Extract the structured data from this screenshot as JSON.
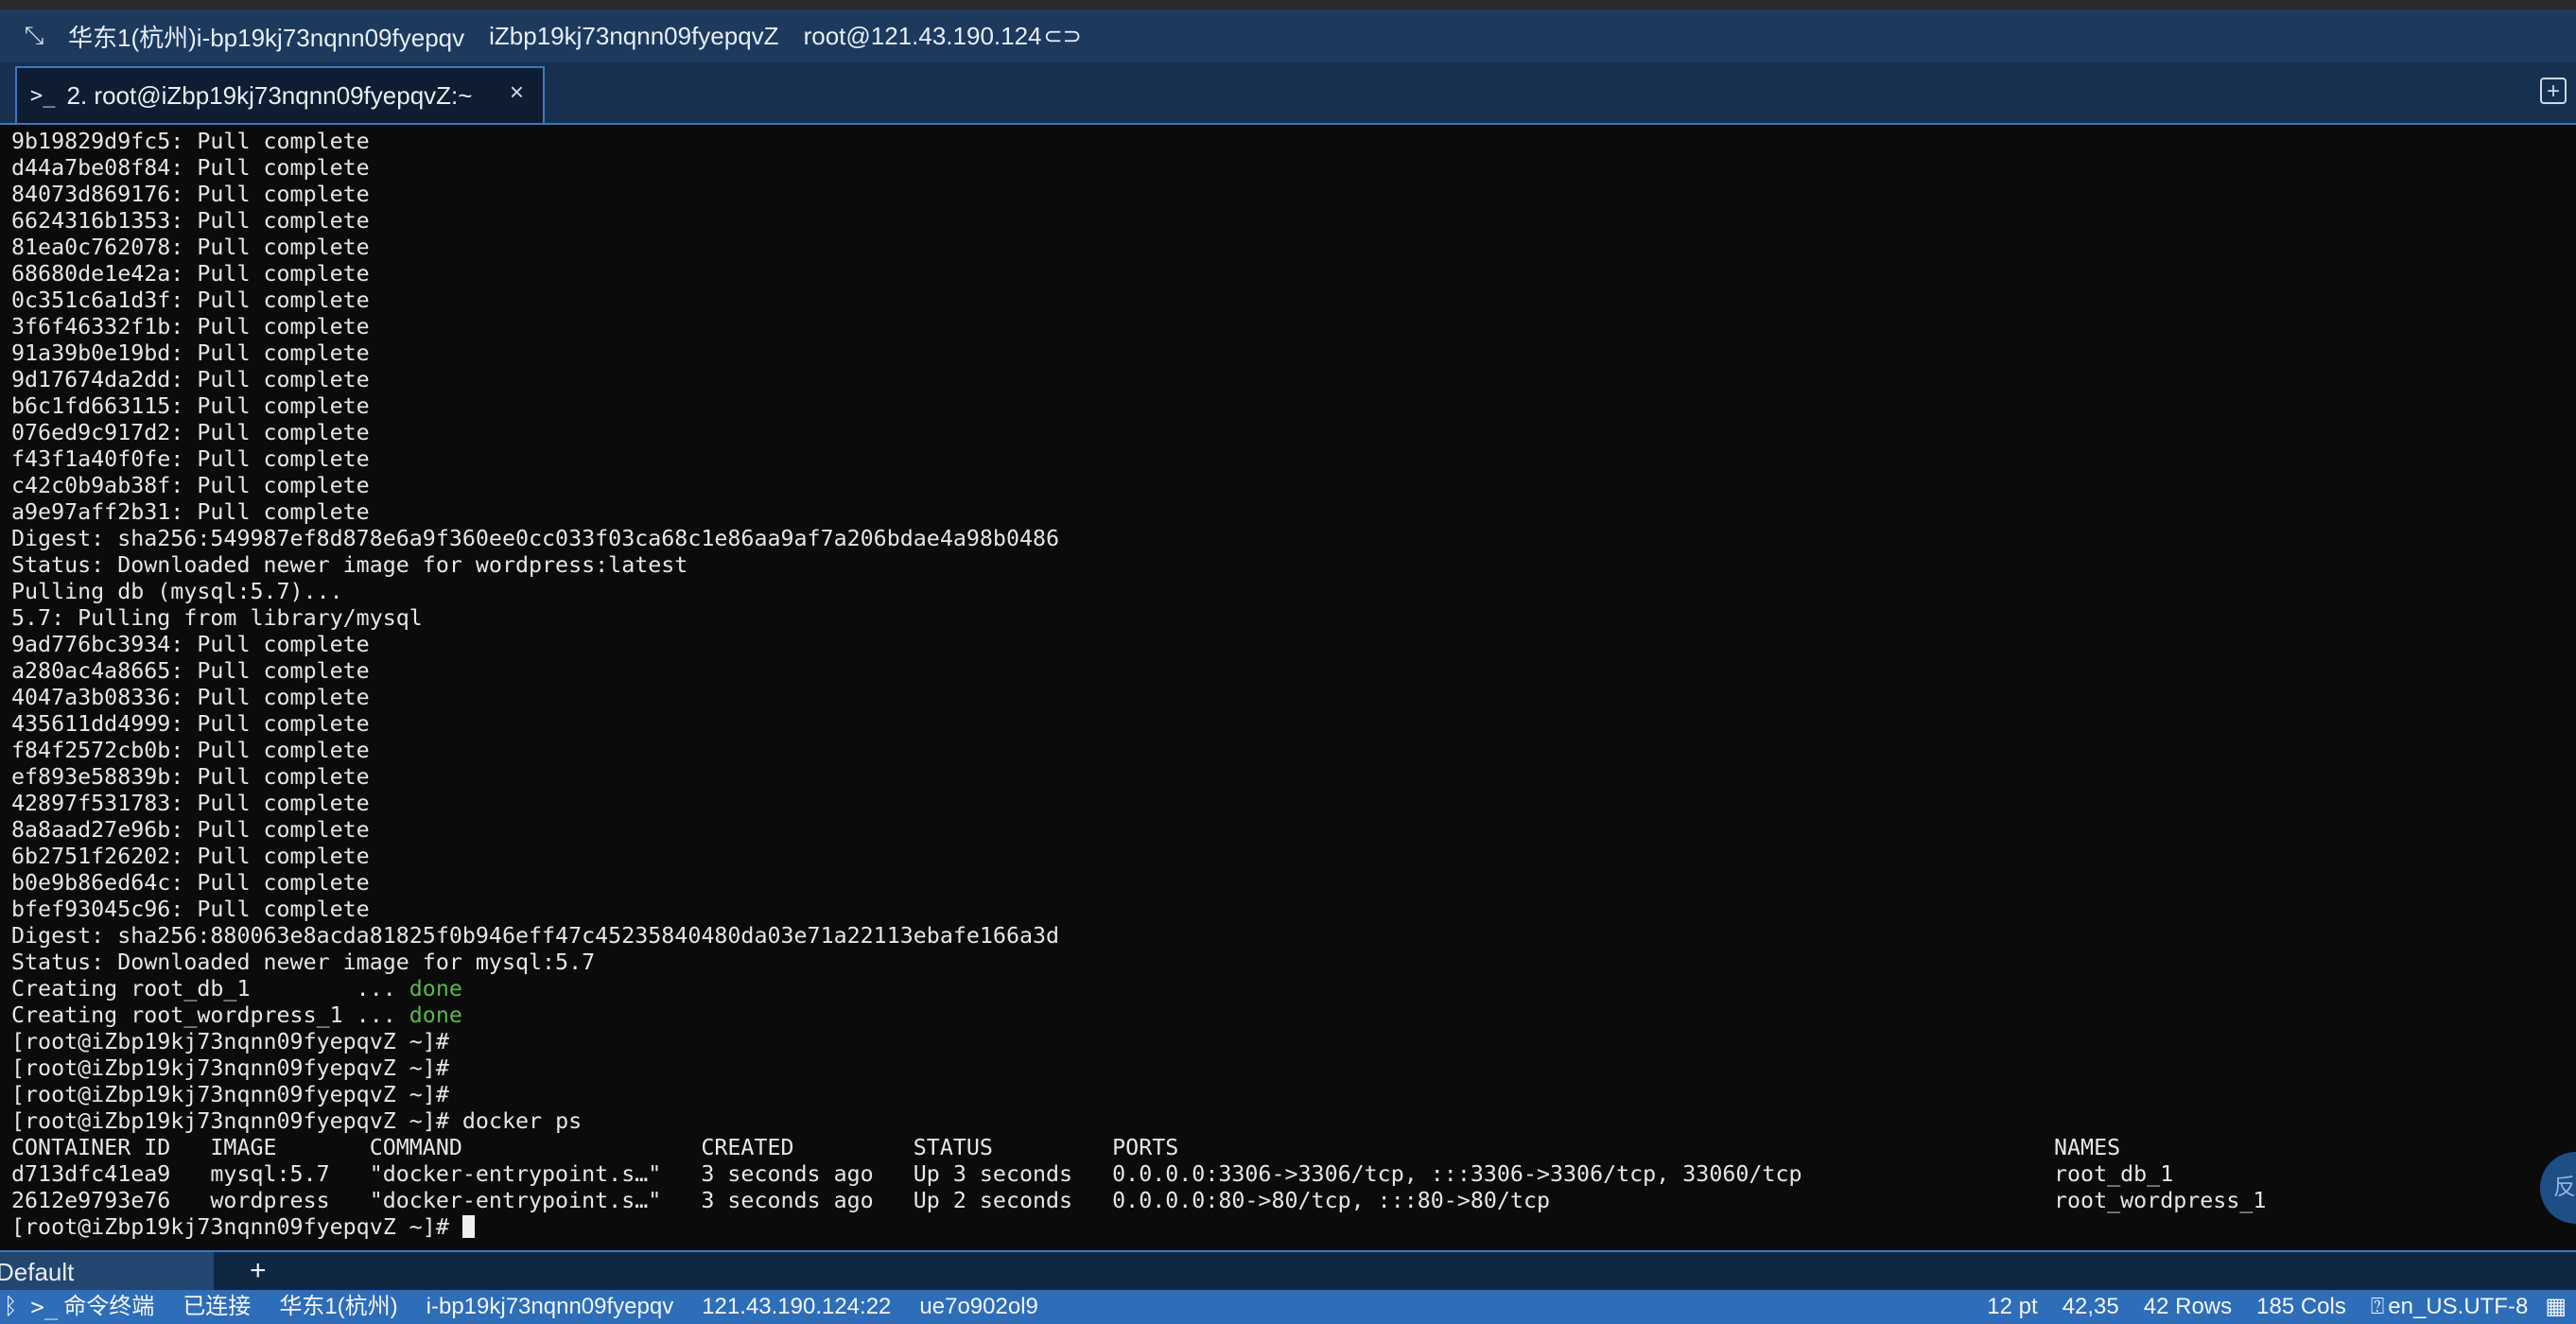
{
  "window": {
    "region": "华东1(杭州)i-bp19kj73nqnn09fyepqv",
    "hostname": "iZbp19kj73nqnn09fyepqvZ",
    "connection": "root@121.43.190.124"
  },
  "tab": {
    "label": "2. root@iZbp19kj73nqnn09fyepqvZ:~",
    "close": "×"
  },
  "terminal": {
    "lines": [
      "9b19829d9fc5: Pull complete",
      "d44a7be08f84: Pull complete",
      "84073d869176: Pull complete",
      "6624316b1353: Pull complete",
      "81ea0c762078: Pull complete",
      "68680de1e42a: Pull complete",
      "0c351c6a1d3f: Pull complete",
      "3f6f46332f1b: Pull complete",
      "91a39b0e19bd: Pull complete",
      "9d17674da2dd: Pull complete",
      "b6c1fd663115: Pull complete",
      "076ed9c917d2: Pull complete",
      "f43f1a40f0fe: Pull complete",
      "c42c0b9ab38f: Pull complete",
      "a9e97aff2b31: Pull complete",
      "Digest: sha256:549987ef8d878e6a9f360ee0cc033f03ca68c1e86aa9af7a206bdae4a98b0486",
      "Status: Downloaded newer image for wordpress:latest",
      "Pulling db (mysql:5.7)...",
      "5.7: Pulling from library/mysql",
      "9ad776bc3934: Pull complete",
      "a280ac4a8665: Pull complete",
      "4047a3b08336: Pull complete",
      "435611dd4999: Pull complete",
      "f84f2572cb0b: Pull complete",
      "ef893e58839b: Pull complete",
      "42897f531783: Pull complete",
      "8a8aad27e96b: Pull complete",
      "6b2751f26202: Pull complete",
      "b0e9b86ed64c: Pull complete",
      "bfef93045c96: Pull complete",
      "Digest: sha256:880063e8acda81825f0b946eff47c45235840480da03e71a22113ebafe166a3d",
      "Status: Downloaded newer image for mysql:5.7"
    ],
    "creating": [
      {
        "text": "Creating root_db_1        ... ",
        "status": "done"
      },
      {
        "text": "Creating root_wordpress_1 ... ",
        "status": "done"
      }
    ],
    "prompt": "[root@iZbp19kj73nqnn09fyepqvZ ~]#",
    "command": "docker ps",
    "ps_header": "CONTAINER ID   IMAGE       COMMAND                  CREATED         STATUS         PORTS                                                                  NAMES",
    "ps_rows": [
      "d713dfc41ea9   mysql:5.7   \"docker-entrypoint.s…\"   3 seconds ago   Up 3 seconds   0.0.0.0:3306->3306/tcp, :::3306->3306/tcp, 33060/tcp                   root_db_1",
      "2612e9793e76   wordpress   \"docker-entrypoint.s…\"   3 seconds ago   Up 2 seconds   0.0.0.0:80->80/tcp, :::80->80/tcp                                      root_wordpress_1"
    ]
  },
  "float_button": "反",
  "session_bar": {
    "tab_label": "Default",
    "add": "+"
  },
  "status_bar": {
    "terminal_label": "命令终端",
    "connection_state": "已连接",
    "region": "华东1(杭州)",
    "instance_id": "i-bp19kj73nqnn09fyepqv",
    "address": "121.43.190.124:22",
    "session_id": "ue7o902ol9",
    "font_size": "12 pt",
    "cursor_pos": "42,35",
    "rows": "42 Rows",
    "cols": "185 Cols",
    "encoding": "en_US.UTF-8"
  }
}
